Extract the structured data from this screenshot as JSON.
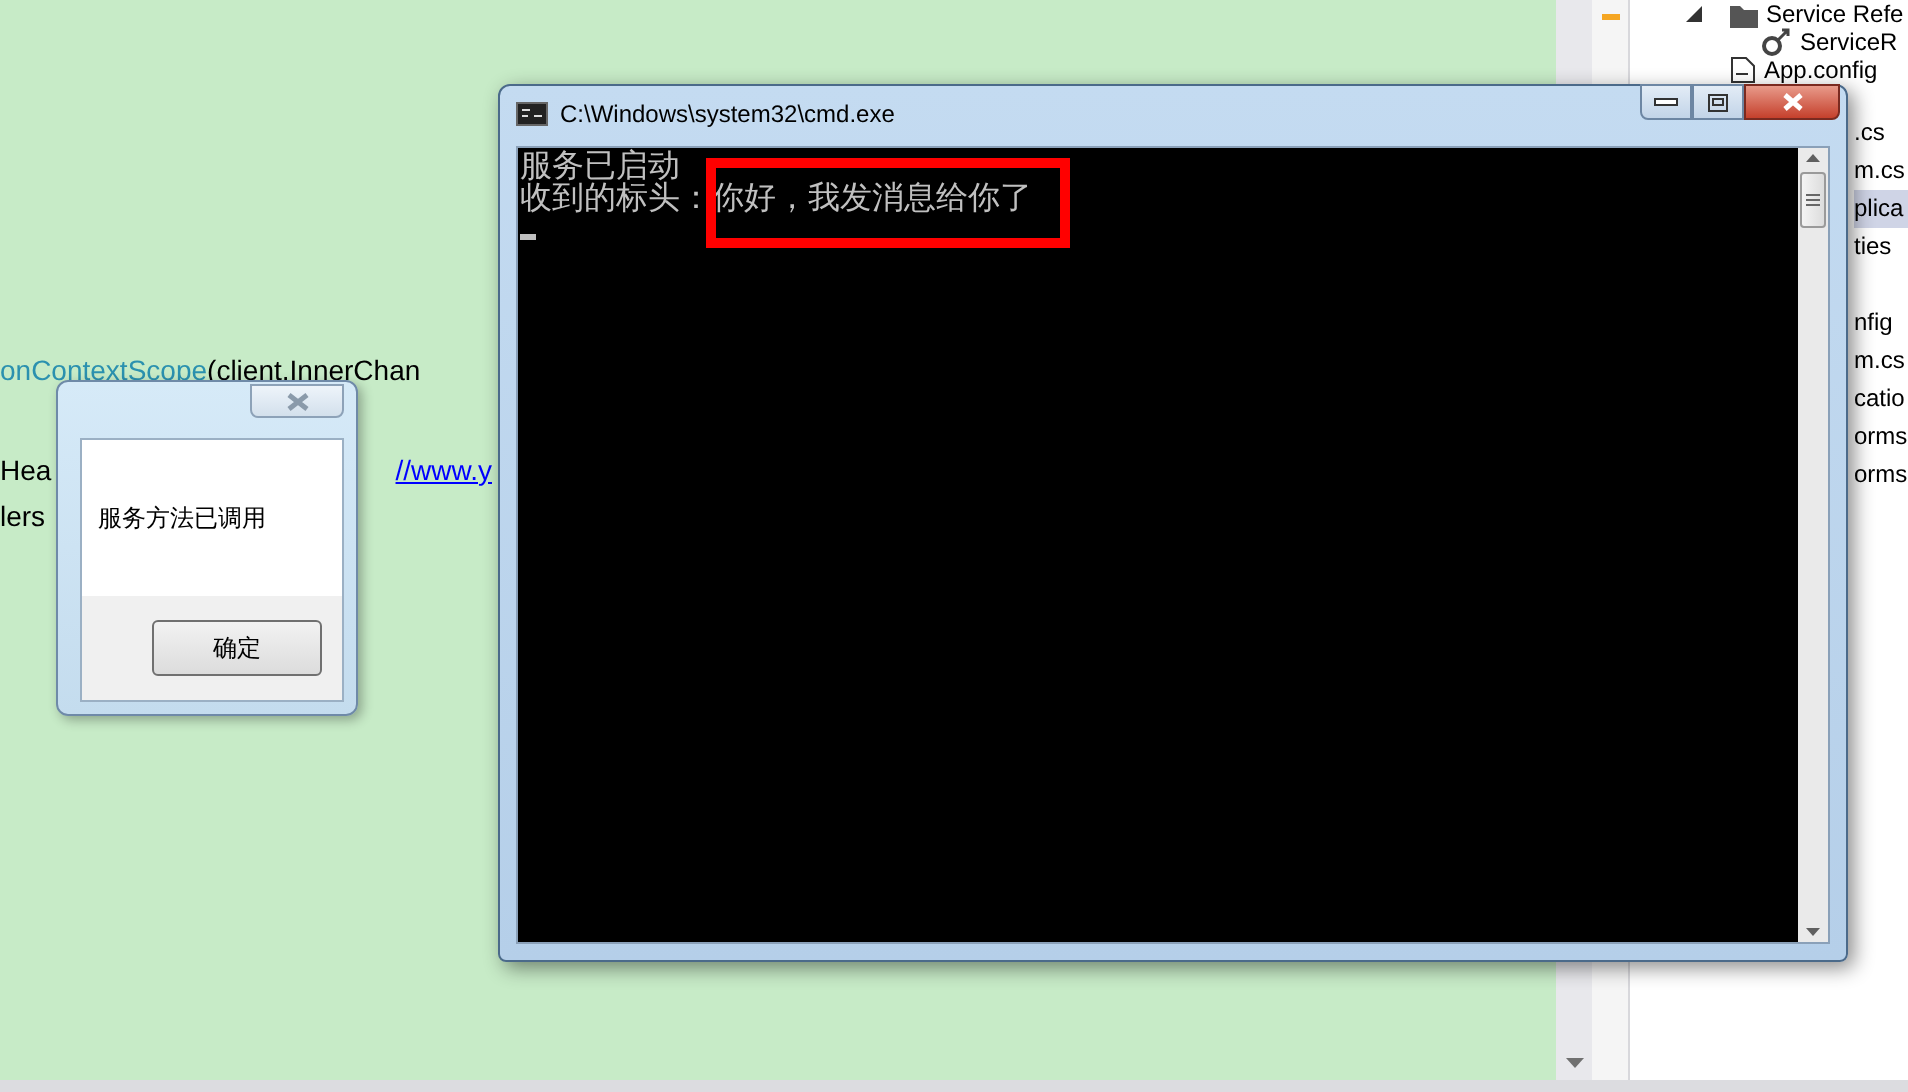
{
  "editor": {
    "lines": [
      {
        "segments": [
          {
            "text": "onContextScope",
            "kind": "type"
          },
          {
            "text": "(client.InnerChan",
            "kind": "plain"
          }
        ]
      },
      {
        "segments": [
          {
            "text": "Hea",
            "kind": "plain"
          },
          {
            "text": "//www.y",
            "kind": "link"
          }
        ]
      },
      {
        "segments": [
          {
            "text": "lers",
            "kind": "plain"
          }
        ]
      }
    ]
  },
  "solution_explorer": {
    "items": [
      {
        "text": "Service Refe",
        "kind": "folder",
        "expanded": true
      },
      {
        "text": "ServiceR",
        "kind": "reference"
      },
      {
        "text": "App.config",
        "kind": "config"
      }
    ],
    "partial_groups": [
      [
        {
          "text": ".cs",
          "selected": false
        },
        {
          "text": "m.cs",
          "selected": false
        },
        {
          "text": "plica",
          "selected": true
        },
        {
          "text": "ties",
          "selected": false
        }
      ],
      [
        {
          "text": "nfig",
          "selected": false
        },
        {
          "text": "m.cs",
          "selected": false
        },
        {
          "text": "catio",
          "selected": false
        },
        {
          "text": "orms",
          "selected": false
        },
        {
          "text": "orms",
          "selected": false
        }
      ]
    ]
  },
  "console_window": {
    "title": "C:\\Windows\\system32\\cmd.exe",
    "lines": [
      [
        {
          "text": "服务已启动",
          "highlighted": false
        }
      ],
      [
        {
          "text": "收到的标头：",
          "highlighted": false
        },
        {
          "text": "你好，我发消息给你了",
          "highlighted": true
        }
      ]
    ]
  },
  "message_box": {
    "message": "服务方法已调用",
    "button": "确定"
  }
}
